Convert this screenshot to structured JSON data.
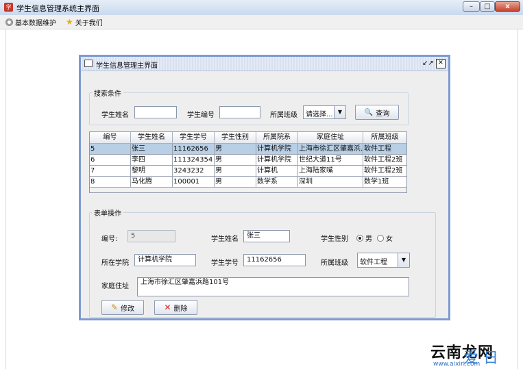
{
  "window": {
    "title": "学生信息管理系统主界面",
    "app_icon_char": "学",
    "min": "–",
    "max": "□",
    "close": "x"
  },
  "menu": {
    "items": [
      {
        "label": "基本数据维护"
      },
      {
        "label": "关于我们"
      }
    ]
  },
  "inner": {
    "title": "学生信息管理主界面",
    "restore": "↙↗",
    "close": "✕"
  },
  "search": {
    "legend": "搜索条件",
    "name_label": "学生姓名",
    "name_value": "",
    "code_label": "学生编号",
    "code_value": "",
    "class_label": "所属班级",
    "class_value": "请选择...",
    "button_label": "查询"
  },
  "table": {
    "headers": [
      "编号",
      "学生姓名",
      "学生学号",
      "学生性别",
      "所属院系",
      "家庭住址",
      "所属班级"
    ],
    "rows": [
      [
        "5",
        "张三",
        "11162656",
        "男",
        "计算机学院",
        "上海市徐汇区肇嘉浜...",
        "软件工程"
      ],
      [
        "6",
        "李四",
        "111324354",
        "男",
        "计算机学院",
        "世纪大道11号",
        "软件工程2班"
      ],
      [
        "7",
        "黎明",
        "3243232",
        "男",
        "计算机",
        "上海陆家嘴",
        "软件工程2班"
      ],
      [
        "8",
        "马化腾",
        "100001",
        "男",
        "数学系",
        "深圳",
        "数学1班"
      ]
    ],
    "selected_row": 0
  },
  "form": {
    "legend": "表单操作",
    "id_label": "编号:",
    "id_value": "5",
    "name_label": "学生姓名",
    "name_value": "张三",
    "gender_label": "学生性别",
    "male": "男",
    "female": "女",
    "gender_selected": "男",
    "college_label": "所在学院",
    "college_value": "计算机学院",
    "code_label": "学生学号",
    "code_value": "11162656",
    "class_label": "所属班级",
    "class_value": "软件工程",
    "address_label": "家庭住址",
    "address_value": "上海市徐汇区肇嘉浜路101号",
    "edit_label": "修改",
    "delete_label": "删除"
  },
  "watermark": {
    "text": "云南龙网",
    "logo": "爱 日",
    "url": "www.aixiri.com"
  }
}
